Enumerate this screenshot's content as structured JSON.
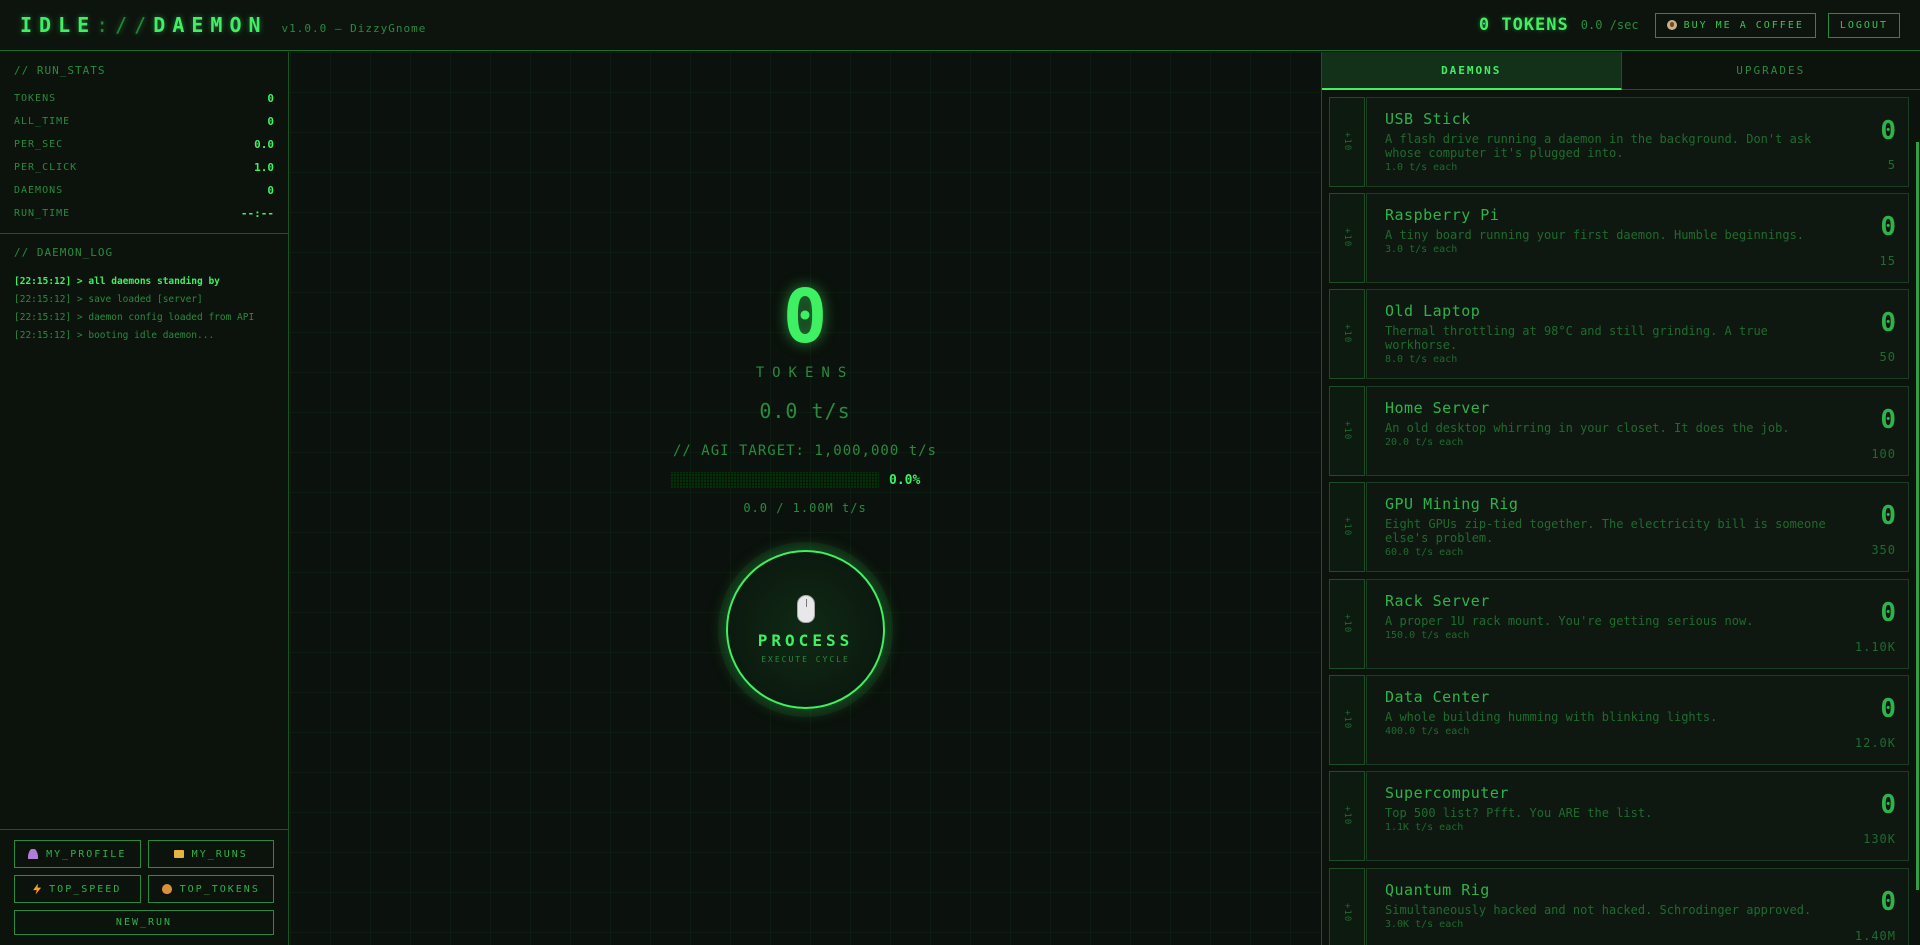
{
  "header": {
    "logo_a": "IDLE",
    "logo_sep": "://",
    "logo_b": "DAEMON",
    "version": "v1.0.0 — DizzyGnome",
    "tokens": "0 TOKENS",
    "per_sec": "0.0 /sec",
    "coffee_label": "BUY ME A COFFEE",
    "logout_label": "LOGOUT"
  },
  "run_stats": {
    "title": "// RUN_STATS",
    "rows": [
      {
        "label": "TOKENS",
        "value": "0"
      },
      {
        "label": "ALL_TIME",
        "value": "0"
      },
      {
        "label": "PER_SEC",
        "value": "0.0"
      },
      {
        "label": "PER_CLICK",
        "value": "1.0"
      },
      {
        "label": "DAEMONS",
        "value": "0"
      },
      {
        "label": "RUN_TIME",
        "value": "--:--"
      }
    ]
  },
  "daemon_log": {
    "title": "// DAEMON_LOG",
    "lines": [
      "[22:15:12] > all daemons standing by",
      "[22:15:12] > save loaded [server]",
      "[22:15:12] > daemon config loaded from API",
      "[22:15:12] > booting idle daemon..."
    ]
  },
  "sidebar_buttons": {
    "profile": "MY_PROFILE",
    "runs": "MY_RUNS",
    "top_speed": "TOP_SPEED",
    "top_tokens": "TOP_TOKENS",
    "new_run": "NEW_RUN"
  },
  "main": {
    "count": "0",
    "tokens_label": "TOKENS",
    "rate": "0.0 t/s",
    "agi_target": "// AGI TARGET: 1,000,000 t/s",
    "progress_pct": "0.0%",
    "progress_value": 0.0,
    "progress_sub": "0.0 / 1.00M t/s",
    "process_label": "PROCESS",
    "process_sub": "EXECUTE CYCLE"
  },
  "tabs": {
    "daemons": "DAEMONS",
    "upgrades": "UPGRADES"
  },
  "daemons": [
    {
      "name": "USB Stick",
      "desc": "A flash drive running a daemon in the background. Don't ask whose computer it's plugged into.",
      "rate": "1.0 t/s each",
      "owned": "0",
      "cost": "5",
      "btn": "+10"
    },
    {
      "name": "Raspberry Pi",
      "desc": "A tiny board running your first daemon. Humble beginnings.",
      "rate": "3.0 t/s each",
      "owned": "0",
      "cost": "15",
      "btn": "+10"
    },
    {
      "name": "Old Laptop",
      "desc": "Thermal throttling at 98°C and still grinding. A true workhorse.",
      "rate": "8.0 t/s each",
      "owned": "0",
      "cost": "50",
      "btn": "+10"
    },
    {
      "name": "Home Server",
      "desc": "An old desktop whirring in your closet. It does the job.",
      "rate": "20.0 t/s each",
      "owned": "0",
      "cost": "100",
      "btn": "+10"
    },
    {
      "name": "GPU Mining Rig",
      "desc": "Eight GPUs zip-tied together. The electricity bill is someone else's problem.",
      "rate": "60.0 t/s each",
      "owned": "0",
      "cost": "350",
      "btn": "+10"
    },
    {
      "name": "Rack Server",
      "desc": "A proper 1U rack mount. You're getting serious now.",
      "rate": "150.0 t/s each",
      "owned": "0",
      "cost": "1.10K",
      "btn": "+10"
    },
    {
      "name": "Data Center",
      "desc": "A whole building humming with blinking lights.",
      "rate": "400.0 t/s each",
      "owned": "0",
      "cost": "12.0K",
      "btn": "+10"
    },
    {
      "name": "Supercomputer",
      "desc": "Top 500 list? Pfft. You ARE the list.",
      "rate": "1.1K t/s each",
      "owned": "0",
      "cost": "130K",
      "btn": "+10"
    },
    {
      "name": "Quantum Rig",
      "desc": "Simultaneously hacked and not hacked. Schrodinger approved.",
      "rate": "3.0K t/s each",
      "owned": "0",
      "cost": "1.40M",
      "btn": "+10"
    }
  ]
}
